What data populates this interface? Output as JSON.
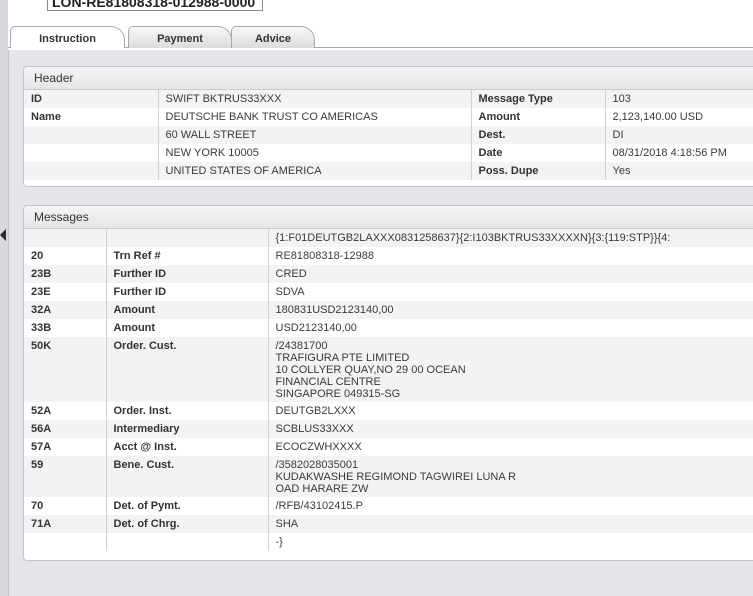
{
  "reference": "LON-RE81808318-012988-0000",
  "tabs": [
    {
      "label": "Instruction"
    },
    {
      "label": "Payment"
    },
    {
      "label": "Advice"
    }
  ],
  "header": {
    "title": "Header",
    "rows": [
      {
        "k1": "ID",
        "v1": "SWIFT BKTRUS33XXX",
        "k2": "Message Type",
        "v2": "103"
      },
      {
        "k1": "Name",
        "v1": "DEUTSCHE BANK TRUST CO AMERICAS",
        "k2": "Amount",
        "v2": "2,123,140.00 USD"
      },
      {
        "k1": "",
        "v1": "60 WALL STREET",
        "k2": "Dest.",
        "v2": "DI"
      },
      {
        "k1": "",
        "v1": "NEW YORK 10005",
        "k2": "Date",
        "v2": "08/31/2018 4:18:56 PM"
      },
      {
        "k1": "",
        "v1": "UNITED STATES OF AMERICA",
        "k2": "Poss. Dupe",
        "v2": "Yes"
      }
    ]
  },
  "messages": {
    "title": "Messages",
    "rows": [
      {
        "tag": "",
        "field": "",
        "value": [
          "{1:F01DEUTGB2LAXXX0831258637}{2:I103BKTRUS33XXXXN}{3:{119:STP}}{4:"
        ]
      },
      {
        "tag": "20",
        "field": "Trn Ref #",
        "value": [
          "RE81808318-12988"
        ]
      },
      {
        "tag": "23B",
        "field": "Further ID",
        "value": [
          "CRED"
        ]
      },
      {
        "tag": "23E",
        "field": "Further ID",
        "value": [
          "SDVA"
        ]
      },
      {
        "tag": "32A",
        "field": "Amount",
        "value": [
          "180831USD2123140,00"
        ]
      },
      {
        "tag": "33B",
        "field": "Amount",
        "value": [
          "USD2123140,00"
        ]
      },
      {
        "tag": "50K",
        "field": "Order. Cust.",
        "value": [
          "/24381700",
          "TRAFIGURA PTE LIMITED",
          "10 COLLYER QUAY,NO 29 00 OCEAN",
          "FINANCIAL CENTRE",
          "SINGAPORE 049315-SG"
        ]
      },
      {
        "tag": "52A",
        "field": "Order. Inst.",
        "value": [
          "DEUTGB2LXXX"
        ]
      },
      {
        "tag": "56A",
        "field": "Intermediary",
        "value": [
          "SCBLUS33XXX"
        ]
      },
      {
        "tag": "57A",
        "field": "Acct @ Inst.",
        "value": [
          "ECOCZWHXXXX"
        ]
      },
      {
        "tag": "59",
        "field": "Bene. Cust.",
        "value": [
          "/3582028035001",
          "KUDAKWASHE REGIMOND TAGWIREI LUNA R",
          "OAD HARARE ZW"
        ]
      },
      {
        "tag": "70",
        "field": "Det. of Pymt.",
        "value": [
          "/RFB/43102415.P"
        ]
      },
      {
        "tag": "71A",
        "field": "Det. of Chrg.",
        "value": [
          "SHA"
        ]
      },
      {
        "tag": "",
        "field": "",
        "value": [
          "-}"
        ]
      }
    ]
  }
}
